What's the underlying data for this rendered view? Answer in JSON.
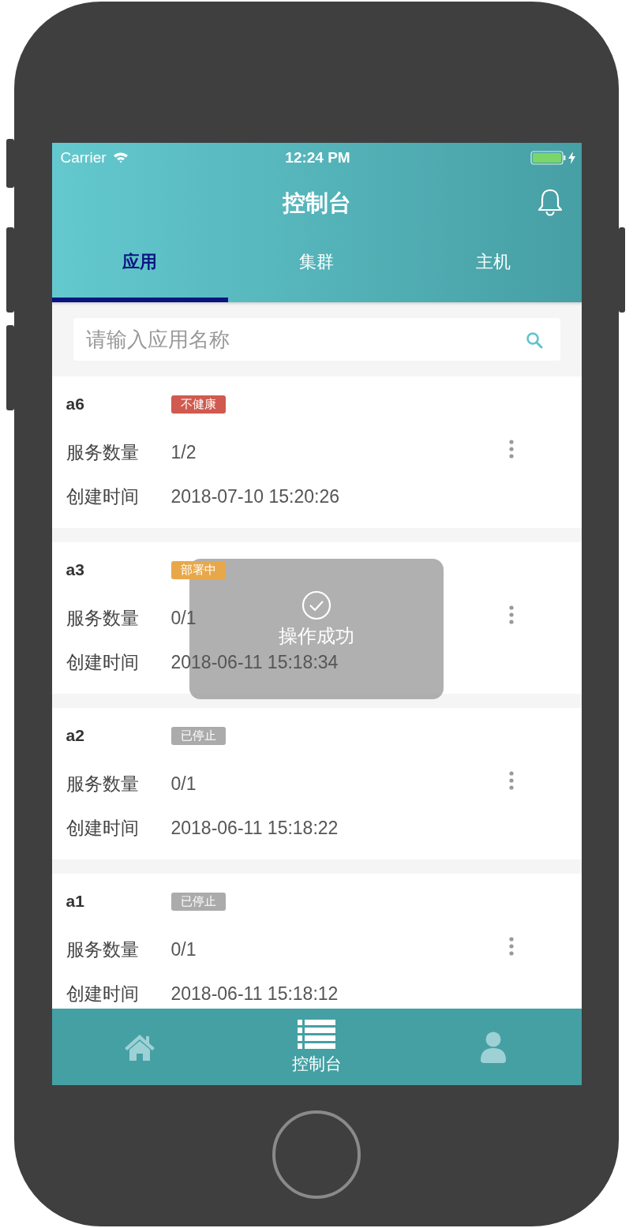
{
  "status_bar": {
    "carrier": "Carrier",
    "time": "12:24 PM"
  },
  "header": {
    "title": "控制台"
  },
  "tabs": [
    {
      "label": "应用",
      "selected": true
    },
    {
      "label": "集群",
      "selected": false
    },
    {
      "label": "主机",
      "selected": false
    }
  ],
  "search": {
    "placeholder": "请输入应用名称"
  },
  "apps": [
    {
      "name": "a6",
      "status": "不健康",
      "color": "#d05a4f",
      "fields": [
        {
          "label": "服务数量",
          "value": "1/2"
        },
        {
          "label": "创建时间",
          "value": "2018-07-10 15:20:26"
        }
      ]
    },
    {
      "name": "a3",
      "status": "部署中",
      "color": "#e8a84a",
      "fields": [
        {
          "label": "服务数量",
          "value": "0/1"
        },
        {
          "label": "创建时间",
          "value": "2018-06-11 15:18:34"
        }
      ]
    },
    {
      "name": "a2",
      "status": "已停止",
      "color": "#ababab",
      "fields": [
        {
          "label": "服务数量",
          "value": "0/1"
        },
        {
          "label": "创建时间",
          "value": "2018-06-11 15:18:22"
        }
      ]
    },
    {
      "name": "a1",
      "status": "已停止",
      "color": "#ababab",
      "fields": [
        {
          "label": "服务数量",
          "value": "0/1"
        },
        {
          "label": "创建时间",
          "value": "2018-06-11 15:18:12"
        }
      ]
    }
  ],
  "toast": {
    "message": "操作成功"
  },
  "bottom_nav": [
    {
      "kind": "home",
      "selected": false
    },
    {
      "kind": "list",
      "label": "控制台",
      "selected": true
    },
    {
      "kind": "user",
      "selected": false
    }
  ]
}
